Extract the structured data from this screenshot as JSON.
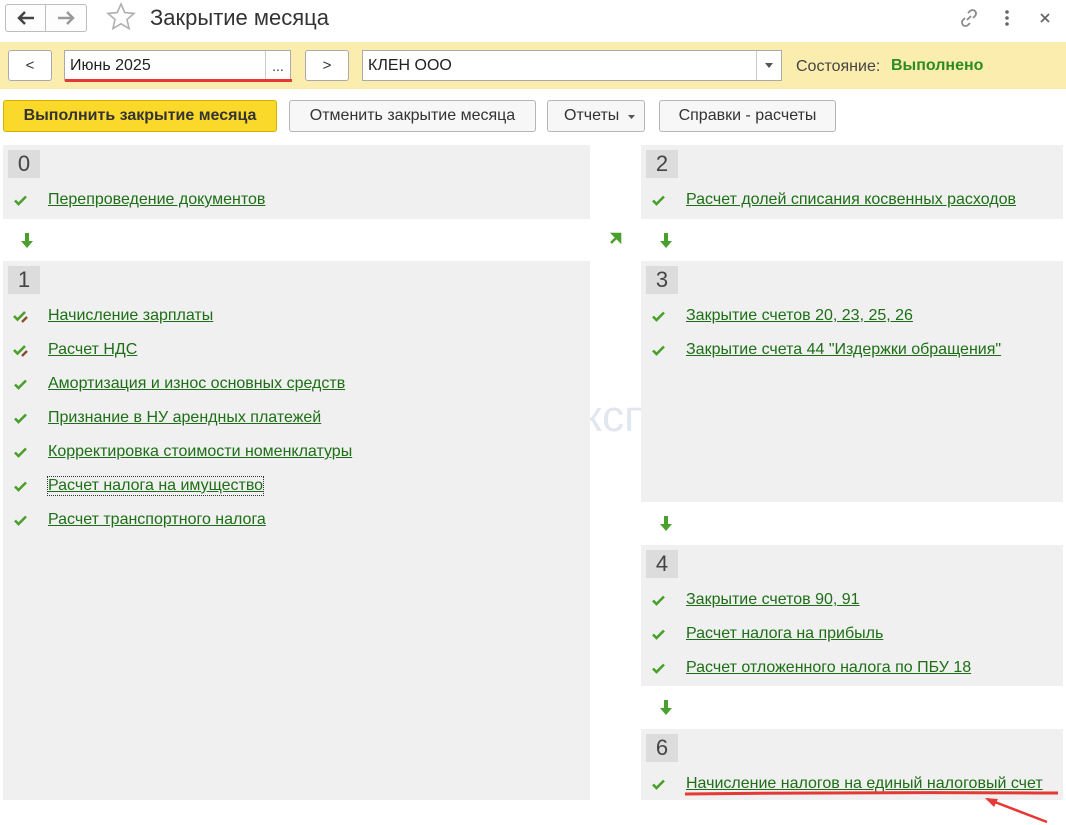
{
  "window": {
    "title": "Закрытие месяца"
  },
  "toolbar": {
    "prev_label": "<",
    "period_value": "Июнь 2025",
    "period_btn": "...",
    "next_label": ">",
    "org_value": "КЛЕН ООО",
    "status_label": "Состояние:",
    "status_value": "Выполнено"
  },
  "commands": {
    "run": "Выполнить закрытие месяца",
    "cancel": "Отменить закрытие месяца",
    "reports": "Отчеты",
    "references": "Справки - расчеты"
  },
  "watermark": "Бухэксперт",
  "stages": [
    {
      "number": "0",
      "items": [
        "Перепроведение документов"
      ]
    },
    {
      "number": "1",
      "items": [
        "Начисление зарплаты",
        "Расчет НДС",
        "Амортизация и износ основных средств",
        "Признание в НУ арендных платежей",
        "Корректировка стоимости номенклатуры",
        "Расчет налога на имущество",
        "Расчет транспортного налога"
      ]
    },
    {
      "number": "2",
      "items": [
        "Расчет долей списания косвенных расходов"
      ]
    },
    {
      "number": "3",
      "items": [
        "Закрытие счетов 20, 23, 25, 26",
        "Закрытие счета 44 \"Издержки обращения\""
      ]
    },
    {
      "number": "4",
      "items": [
        "Закрытие счетов 90, 91",
        "Расчет налога на прибыль",
        "Расчет отложенного налога по ПБУ 18"
      ]
    },
    {
      "number": "6",
      "items": [
        "Начисление налогов на единый налоговый счет"
      ]
    }
  ],
  "colors": {
    "accent_yellow": "#fbd92a",
    "toolbar_bg": "#fbedae",
    "link_green": "#1d6e16",
    "check_green": "#4aa02c",
    "annotation_red": "#e53935"
  }
}
